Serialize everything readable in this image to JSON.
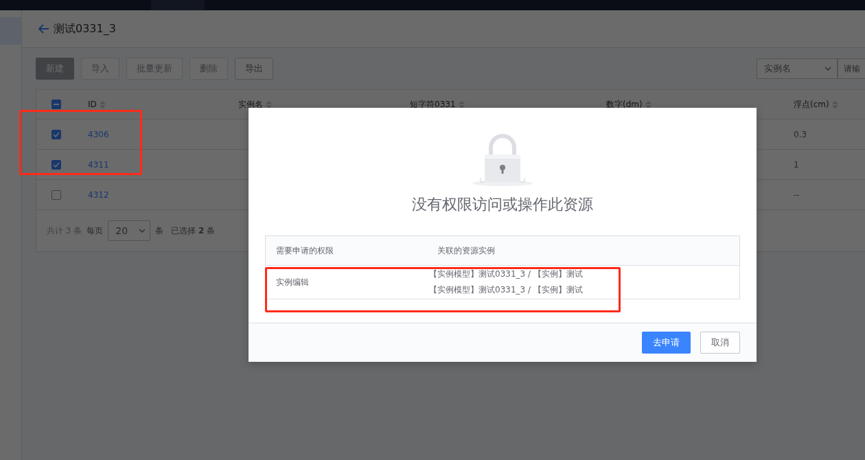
{
  "page": {
    "title": "测试0331_3"
  },
  "toolbar": {
    "buttons": [
      {
        "label": "新建",
        "kind": "primary",
        "disabled": true
      },
      {
        "label": "导入",
        "kind": "default",
        "disabled": true
      },
      {
        "label": "批量更新",
        "kind": "default",
        "disabled": true
      },
      {
        "label": "删除",
        "kind": "default",
        "disabled": true
      },
      {
        "label": "导出",
        "kind": "default",
        "disabled": false
      }
    ],
    "search": {
      "field": "实例名",
      "placeholder": "请输"
    }
  },
  "table": {
    "header_checkbox": {
      "indeterminate": true
    },
    "columns": [
      "ID",
      "实例名",
      "短字符0331",
      "数字(dm)",
      "浮点(cm)"
    ],
    "rows": [
      {
        "checked": true,
        "id": "4306",
        "float": "0.3"
      },
      {
        "checked": true,
        "id": "4311",
        "float": "1"
      },
      {
        "checked": false,
        "id": "4312",
        "float": "--"
      }
    ]
  },
  "pagination": {
    "total": "共计 3 条",
    "per_page_label": "每页",
    "per_page": "20",
    "unit": "条",
    "selected": "已选择 **2** 条"
  },
  "dialog": {
    "title": "没有权限访问或操作此资源",
    "columns": [
      "需要申请的权限",
      "关联的资源实例"
    ],
    "rows": [
      {
        "permission": "实例编辑",
        "instances": [
          "【实例模型】测试0331_3 / 【实例】测试",
          "【实例模型】测试0331_3 / 【实例】测试"
        ]
      }
    ],
    "buttons": [
      {
        "label": "去申请",
        "kind": "primary"
      },
      {
        "label": "取消",
        "kind": "default"
      }
    ]
  }
}
